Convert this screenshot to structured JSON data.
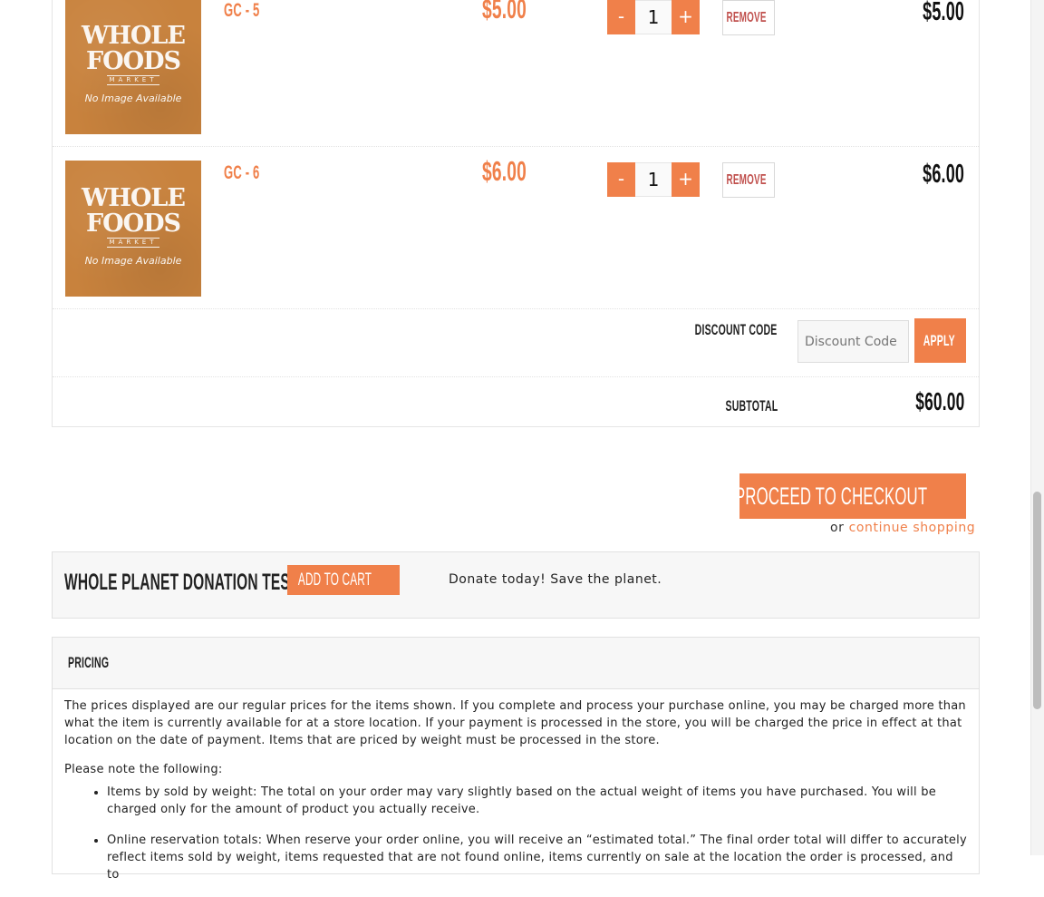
{
  "cart": {
    "items": [
      {
        "name": "GC - 5",
        "price": "$5.00",
        "quantity": "1",
        "total": "$5.00",
        "image_alt": "No Image Available"
      },
      {
        "name": "GC - 6",
        "price": "$6.00",
        "quantity": "1",
        "total": "$6.00",
        "image_alt": "No Image Available"
      }
    ],
    "thumb": {
      "brand_line1": "WHOLE",
      "brand_line2": "FOODS",
      "brand_line3": "MARKET"
    },
    "qty_minus": "-",
    "qty_plus": "+",
    "remove_label": "REMOVE",
    "discount": {
      "label": "DISCOUNT CODE",
      "placeholder": "Discount Code",
      "apply_label": "APPLY"
    },
    "subtotal": {
      "label": "SUBTOTAL",
      "value": "$60.00"
    }
  },
  "checkout": {
    "button_label": "PROCEED TO CHECKOUT",
    "or_text": "or",
    "continue_label": "continue shopping"
  },
  "donation": {
    "title": "WHOLE PLANET DONATION TEST",
    "add_label": "ADD TO CART",
    "message": "Donate today! Save the planet."
  },
  "pricing": {
    "heading": "PRICING",
    "paragraph": "The prices displayed are our regular prices for the items shown. If you complete and process your purchase online, you may be charged more than what the item is currently available for at a store location. If your payment is processed in the store, you will be charged the price in effect at that location on the date of payment. Items that are priced by weight must be processed in the store.",
    "note": "Please note the following:",
    "bullets": [
      "Items by sold by weight: The total on your order may vary slightly based on the actual weight of items you have purchased. You will be charged only for the amount of product you actually receive.",
      "Online reservation totals: When reserve your order online, you will receive an “estimated total.” The final order total will differ to accurately reflect items sold by weight, items requested that are not found online, items currently on sale at the location the order is processed, and to"
    ]
  },
  "colors": {
    "accent": "#f0804a",
    "remove_text": "#c0504d",
    "panel_bg": "#f7f7f7",
    "thumb_bg": "#c8823d"
  }
}
